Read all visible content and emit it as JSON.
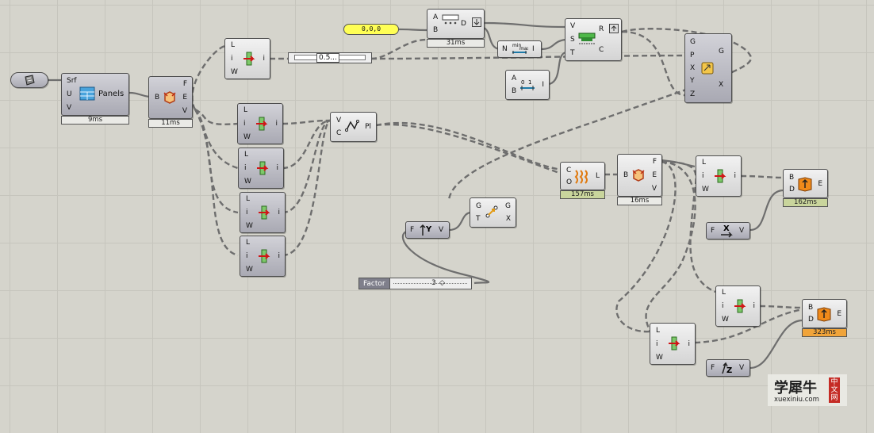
{
  "wire_color": "#6e6e6e",
  "components": {
    "ref": {
      "icon": "surface-reference-icon"
    },
    "panels": {
      "inputs": [
        "Srf",
        "U",
        "V"
      ],
      "title": "Panels",
      "time": "9ms",
      "icon": "panels-icon"
    },
    "explode": {
      "inputs": [
        "B"
      ],
      "outputs": [
        "F",
        "E",
        "V"
      ],
      "time": "11ms",
      "icon": "deconstruct-brep-icon"
    },
    "list_a": {
      "inputs": [
        "L",
        "i",
        "W"
      ],
      "output": "i",
      "icon": "list-item-icon"
    },
    "list_b": {
      "inputs": [
        "L",
        "i",
        "W"
      ],
      "output": "i",
      "icon": "list-item-icon"
    },
    "list_c": {
      "inputs": [
        "L",
        "i",
        "W"
      ],
      "output": "i",
      "icon": "list-item-icon"
    },
    "list_d": {
      "inputs": [
        "L",
        "i",
        "W"
      ],
      "output": "i",
      "icon": "list-item-icon"
    },
    "list_e": {
      "inputs": [
        "L",
        "i",
        "W"
      ],
      "output": "i",
      "icon": "list-item-icon"
    },
    "panel_xyz": {
      "value": "0,0,0",
      "color": "#ffff55"
    },
    "slider_half": {
      "value": "0.5..."
    },
    "divide": {
      "inputs": [
        "A",
        "B"
      ],
      "output": "D",
      "time": "31ms",
      "icon": "division-icon"
    },
    "bounds": {
      "input": "N",
      "output": "I",
      "icon": "bounds-icon"
    },
    "subtract": {
      "inputs": [
        "A",
        "B"
      ],
      "output": "I",
      "icon": "construct-domain-icon"
    },
    "stack": {
      "inputs": [
        "V",
        "S",
        "T"
      ],
      "outputs": [
        "R",
        "C"
      ],
      "icon": "stack-icon"
    },
    "scale": {
      "inputs": [
        "G",
        "P",
        "X",
        "Y",
        "Z"
      ],
      "outputs": [
        "G",
        "X"
      ],
      "icon": "scale-nu-icon"
    },
    "polyline": {
      "inputs": [
        "V",
        "C"
      ],
      "output": "Pl",
      "icon": "polyline-icon"
    },
    "unit_y": {
      "input": "F",
      "output": "V",
      "icon": "unit-y-icon"
    },
    "move": {
      "inputs": [
        "G",
        "T"
      ],
      "outputs": [
        "G",
        "X"
      ],
      "icon": "move-icon"
    },
    "factor": {
      "label": "Factor",
      "value": "3"
    },
    "loft": {
      "inputs": [
        "C",
        "O"
      ],
      "output": "L",
      "time": "157ms",
      "icon": "loft-icon"
    },
    "explode2": {
      "inputs": [
        "B"
      ],
      "outputs": [
        "F",
        "E",
        "V"
      ],
      "time": "16ms",
      "icon": "deconstruct-brep-icon"
    },
    "list_f": {
      "inputs": [
        "L",
        "i",
        "W"
      ],
      "output": "i",
      "icon": "list-item-icon"
    },
    "extrude1": {
      "inputs": [
        "B",
        "D"
      ],
      "output": "E",
      "time": "162ms",
      "icon": "extrude-icon"
    },
    "unit_x": {
      "input": "F",
      "output": "V",
      "icon": "unit-x-icon"
    },
    "list_g": {
      "inputs": [
        "L",
        "i",
        "W"
      ],
      "output": "i",
      "icon": "list-item-icon"
    },
    "list_h": {
      "inputs": [
        "L",
        "i",
        "W"
      ],
      "output": "i",
      "icon": "list-item-icon"
    },
    "extrude2": {
      "inputs": [
        "B",
        "D"
      ],
      "output": "E",
      "time": "323ms",
      "icon": "extrude-icon"
    },
    "unit_z": {
      "input": "F",
      "output": "V",
      "icon": "unit-z-icon"
    }
  },
  "watermark": {
    "title": "学犀牛",
    "url": "xuexiniu.com",
    "badge": "中文网"
  }
}
